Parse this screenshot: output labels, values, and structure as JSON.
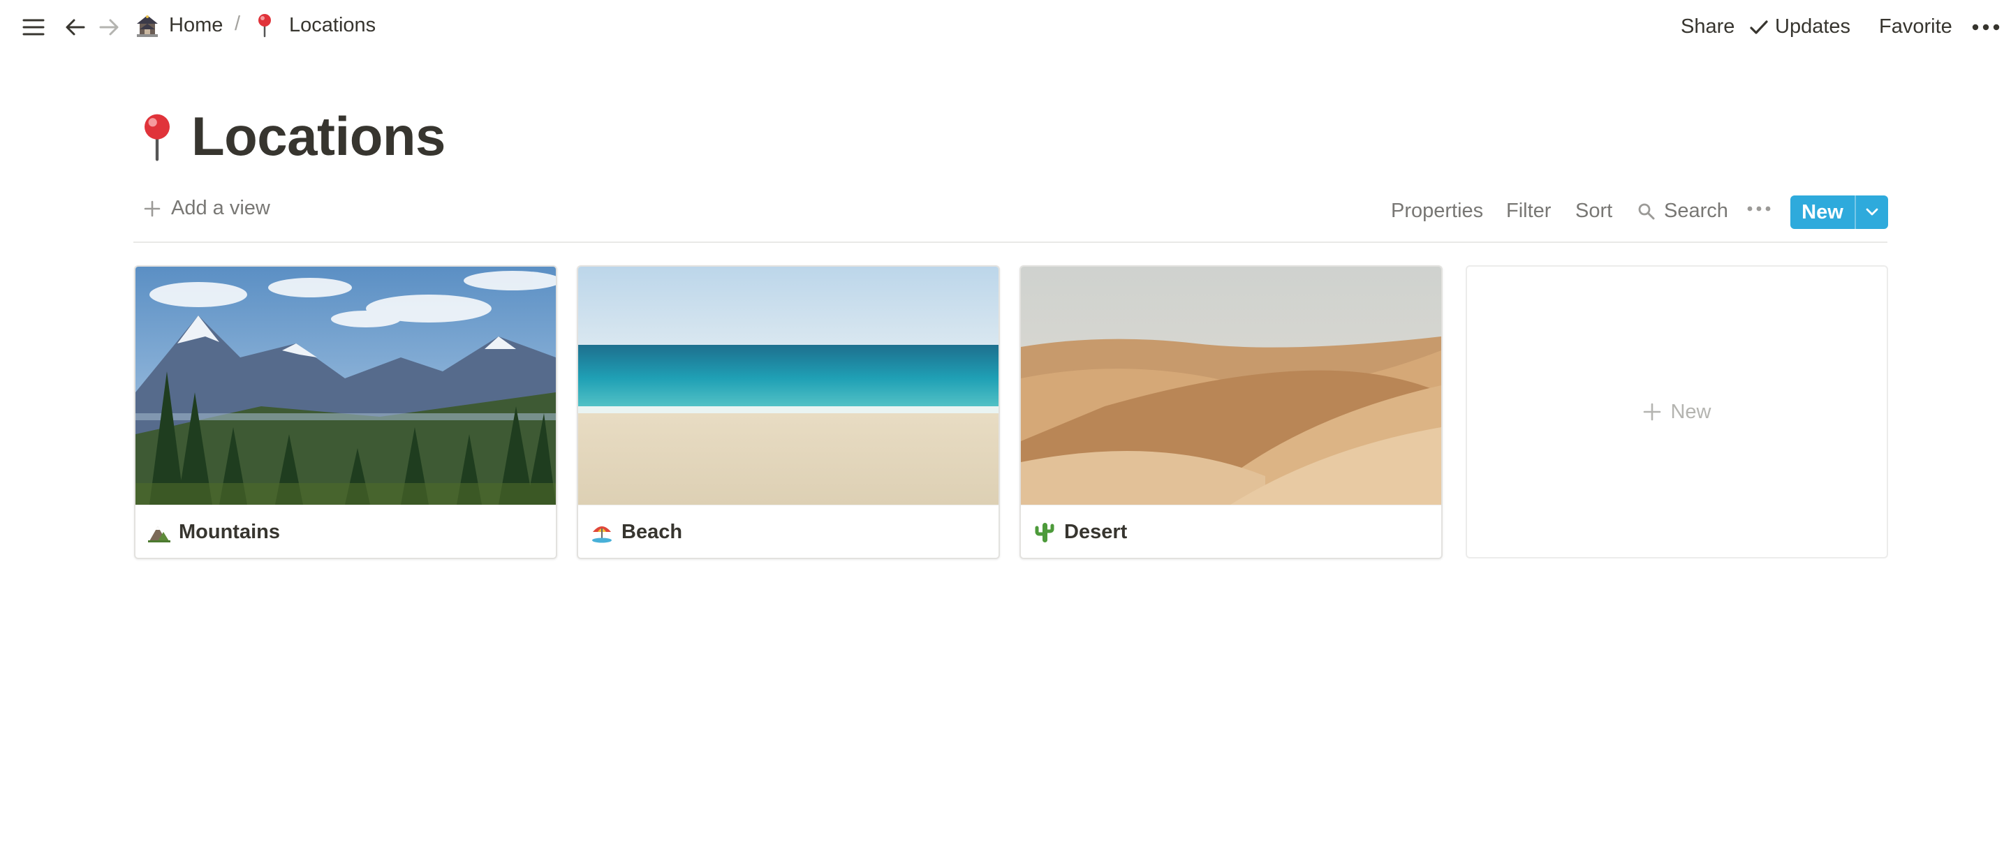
{
  "topbar": {
    "breadcrumb": [
      {
        "label": "Home",
        "icon": "castle-icon"
      },
      {
        "label": "Locations",
        "icon": "pushpin-icon"
      }
    ],
    "separator": "/",
    "share_label": "Share",
    "updates_label": "Updates",
    "favorite_label": "Favorite"
  },
  "page": {
    "title": "Locations",
    "icon": "pushpin-icon"
  },
  "viewbar": {
    "add_view_label": "Add a view",
    "properties_label": "Properties",
    "filter_label": "Filter",
    "sort_label": "Sort",
    "search_label": "Search",
    "new_label": "New"
  },
  "gallery": {
    "cards": [
      {
        "title": "Mountains",
        "icon": "mountain-icon",
        "cover": "mountain-landscape-image"
      },
      {
        "title": "Beach",
        "icon": "beach-umbrella-icon",
        "cover": "beach-ocean-image"
      },
      {
        "title": "Desert",
        "icon": "cactus-icon",
        "cover": "desert-dunes-image"
      }
    ],
    "new_card_label": "New"
  },
  "colors": {
    "accent": "#2eaadc",
    "text": "#37352f",
    "muted": "#787774",
    "divider": "#e9e9e7"
  }
}
